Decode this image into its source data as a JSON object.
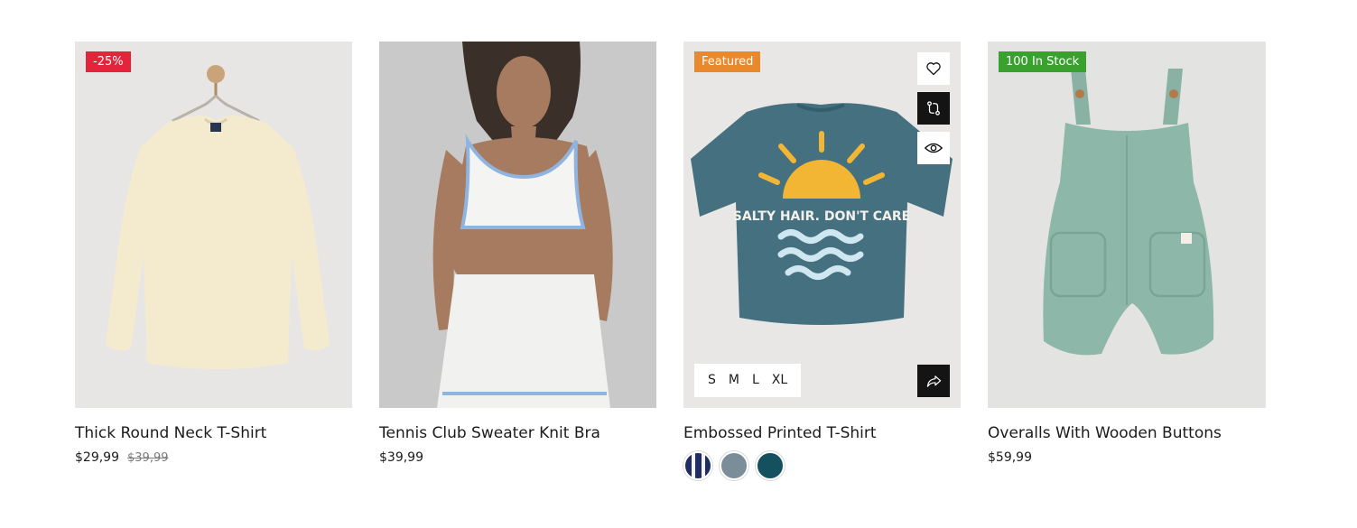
{
  "products": [
    {
      "title": "Thick Round Neck T-Shirt",
      "price": "$29,99",
      "old_price": "$39,99",
      "badge": "-25%",
      "badge_color": "#e3243b",
      "image": "cream-long-sleeve-shirt-on-hanger"
    },
    {
      "title": "Tennis Club Sweater Knit Bra",
      "price": "$39,99",
      "image": "model-in-white-knit-top-and-skirt"
    },
    {
      "title": "Embossed Printed T-Shirt",
      "badge": "Featured",
      "badge_color": "#e8892e",
      "image": "teal-tshirt-salty-hair-print",
      "print_text": "SALTY HAIR. DON'T CARE",
      "sizes": [
        "S",
        "M",
        "L",
        "XL"
      ],
      "colors": [
        "#1f2d63",
        "#7b8d99",
        "#14505e"
      ],
      "actions": [
        "heart-icon",
        "compare-icon",
        "eye-icon",
        "share-icon"
      ]
    },
    {
      "title": "Overalls With Wooden Buttons",
      "price": "$59,99",
      "badge": "100 In Stock",
      "badge_color": "#3aa12f",
      "image": "sage-green-overalls"
    }
  ]
}
